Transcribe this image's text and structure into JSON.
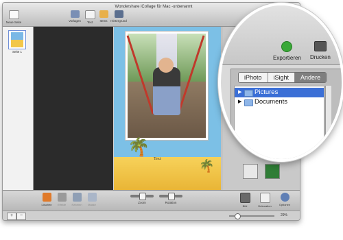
{
  "window": {
    "title": "Wondershare iCollage für Mac -unbenannt"
  },
  "toolbar": {
    "new_page": "Neue Seite",
    "templates": "Vorlagen",
    "text": "Text",
    "items": "Items",
    "background": "Hintergrund"
  },
  "sidebar": {
    "thumb_label": "Seite 1"
  },
  "canvas": {
    "text": "Text"
  },
  "bottom": {
    "delete": "Löschen",
    "effects": "Effekte",
    "rahmen": "Rahmen",
    "masks": "Maske",
    "zoom": "Zoom",
    "rotation": "Rotation",
    "bild": "Bild",
    "dekoration": "Dekoration",
    "optionen": "Optionen"
  },
  "status": {
    "zoom_value": "29%",
    "add": "+",
    "remove": "−"
  },
  "magnifier": {
    "export": "Exportieren",
    "print": "Drucken",
    "tabs": [
      "iPhoto",
      "iSight",
      "Andere"
    ],
    "active_tab": "Andere",
    "tree": [
      {
        "label": "Pictures",
        "selected": true
      },
      {
        "label": "Documents",
        "selected": false
      }
    ]
  },
  "colors": {
    "accent": "#3b6fd6",
    "export_icon": "#3aa838",
    "canvas_sky": "#7cc0e6",
    "sand": "#f2c74a"
  },
  "icons": {
    "export": "export-arrow-icon",
    "print": "printer-icon",
    "folder": "folder-icon"
  }
}
